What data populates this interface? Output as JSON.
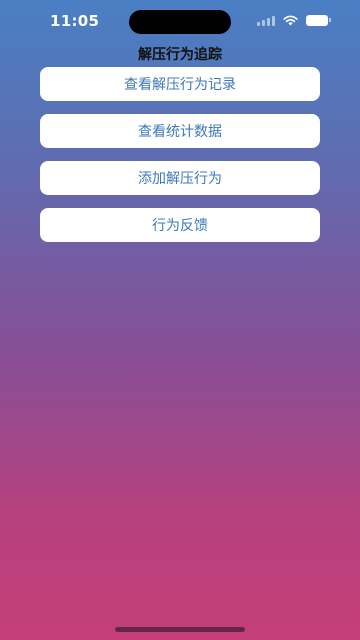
{
  "status_bar": {
    "time": "11:05",
    "icons": [
      "signal-icon",
      "wifi-icon",
      "battery-icon"
    ]
  },
  "nav": {
    "title": "解压行为追踪"
  },
  "menu": {
    "buttons": [
      {
        "label": "查看解压行为记录"
      },
      {
        "label": "查看统计数据"
      },
      {
        "label": "添加解压行为"
      },
      {
        "label": "行为反馈"
      }
    ]
  },
  "colors": {
    "gradient_top": "#4a7fc4",
    "gradient_bottom": "#c63f78",
    "button_bg": "#ffffff",
    "button_text": "#3f78b8"
  }
}
